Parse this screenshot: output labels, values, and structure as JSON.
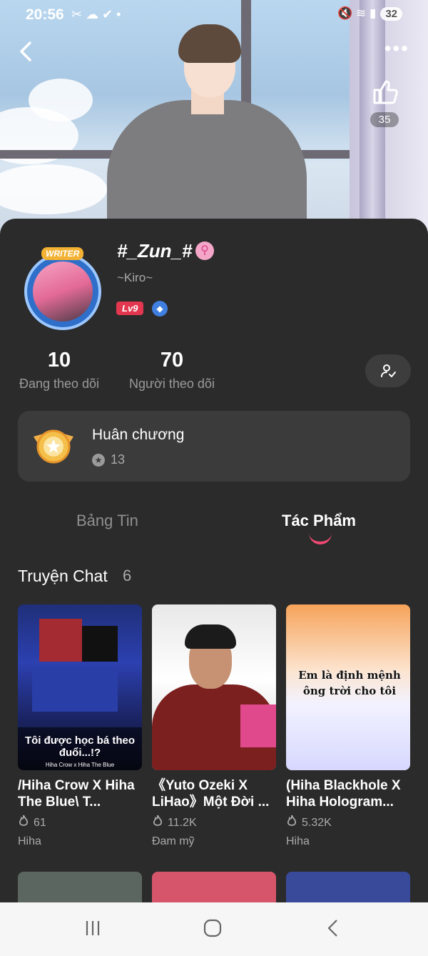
{
  "status_bar": {
    "time": "20:56",
    "notif_icons": "✂ ☁ ✔ •",
    "right_icons": "🔇 ≋ ▮",
    "battery": "32"
  },
  "header": {
    "like_count": "35"
  },
  "profile": {
    "username": "#_Zun_#",
    "gender_symbol": "⚲",
    "nickname": "~Kiro~",
    "avatar_label": "WRITER",
    "level": "Lv9"
  },
  "stats": {
    "following": {
      "value": "10",
      "label": "Đang theo dõi"
    },
    "followers": {
      "value": "70",
      "label": "Người theo dõi"
    }
  },
  "medals": {
    "title": "Huân chương",
    "count": "13"
  },
  "tabs": [
    {
      "label": "Bảng Tin",
      "active": false
    },
    {
      "label": "Tác Phẩm",
      "active": true
    }
  ],
  "section": {
    "title": "Truyện Chat",
    "count": "6"
  },
  "works": [
    {
      "title": "/Hiha Crow X Hiha The Blue\\ T...",
      "reads": "61",
      "author": "Hiha",
      "thumb_caption": "Tôi được học bá theo đuổi...!?",
      "thumb_subcaption": "Hiha Crow x Hiha The Blue"
    },
    {
      "title": "《Yuto Ozeki X LiHao》Một Đời ...",
      "reads": "11.2K",
      "author": "Đam mỹ"
    },
    {
      "title": "(Hiha Blackhole X Hiha Hologram...",
      "reads": "5.32K",
      "author": "Hiha",
      "thumb_caption": "Em là định mệnh ông trời cho tôi"
    }
  ],
  "colors": {
    "accent": "#f04a72",
    "background": "#2b2b2b",
    "card": "#3b3b3b",
    "level_badge": "#e3364f"
  }
}
